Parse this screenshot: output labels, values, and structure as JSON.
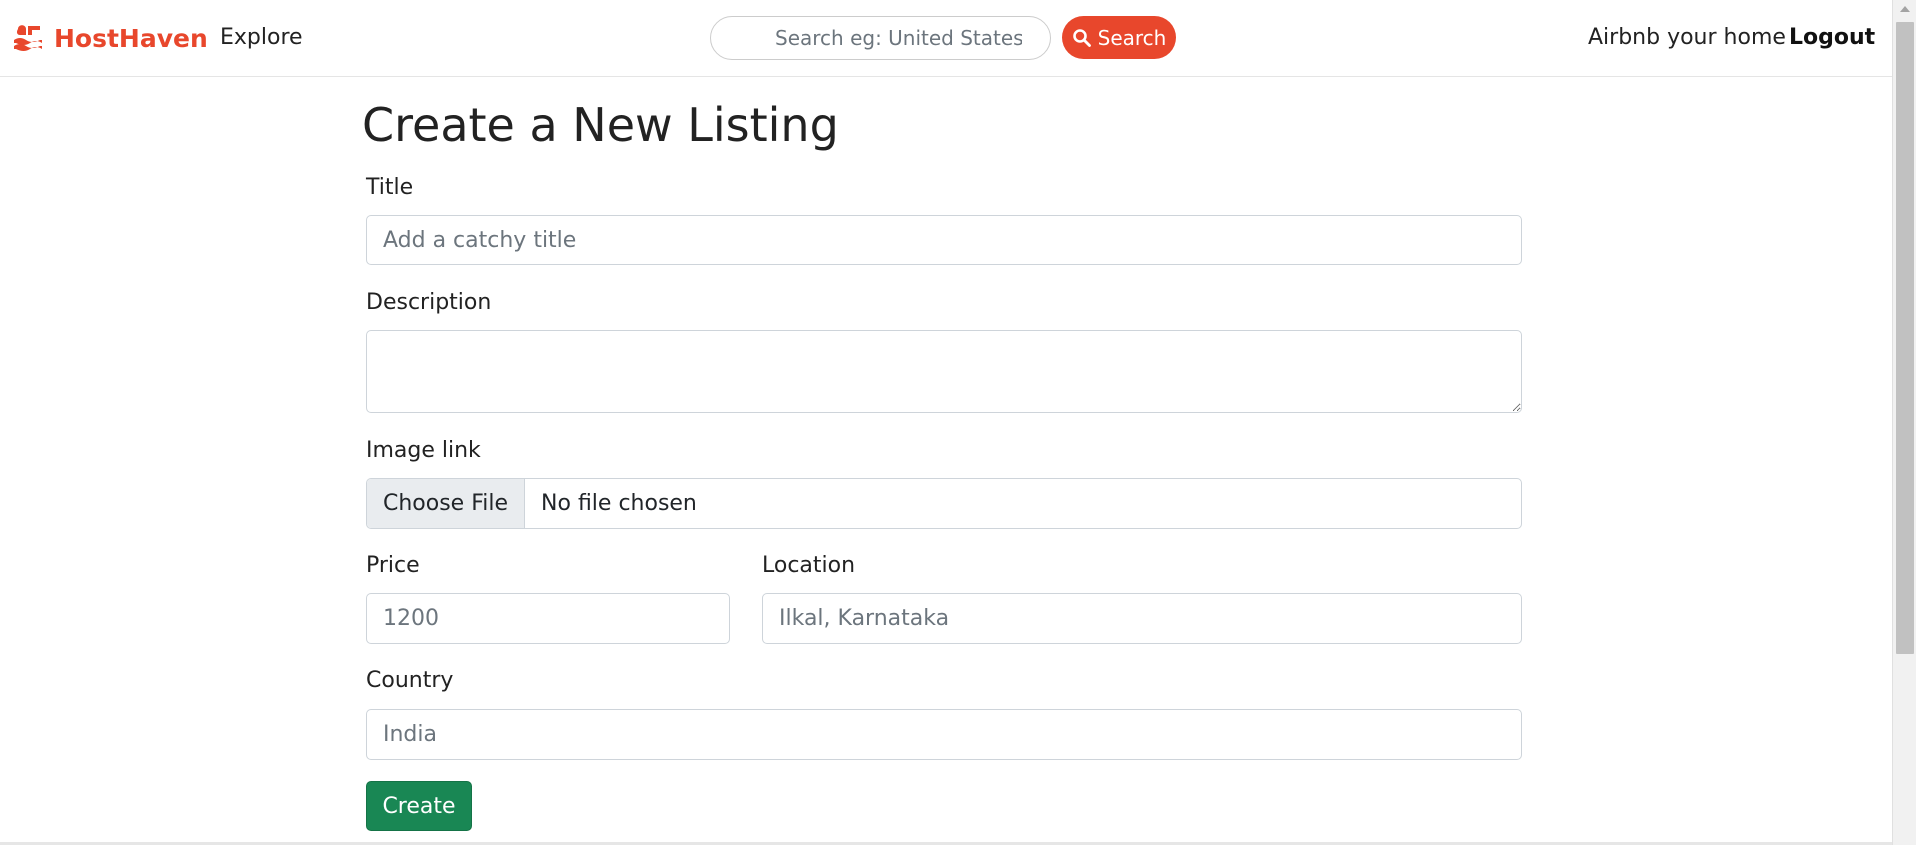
{
  "brand": {
    "name": "HostHaven",
    "color": "#e8472c",
    "icon": "airbnb-logo-icon"
  },
  "nav": {
    "explore": "Explore",
    "search_placeholder": "Search eg: United States",
    "search_button": "Search",
    "host_link": "Airbnb your home",
    "logout": "Logout"
  },
  "form": {
    "heading": "Create a New Listing",
    "title_label": "Title",
    "title_placeholder": "Add a catchy title",
    "description_label": "Description",
    "image_label": "Image link",
    "file_button": "Choose File",
    "file_status": "No file chosen",
    "price_label": "Price",
    "price_placeholder": "1200",
    "location_label": "Location",
    "location_placeholder": "Ilkal, Karnataka",
    "country_label": "Country",
    "country_placeholder": "India",
    "submit": "Create"
  },
  "colors": {
    "accent": "#e8472c",
    "submit": "#198754"
  }
}
